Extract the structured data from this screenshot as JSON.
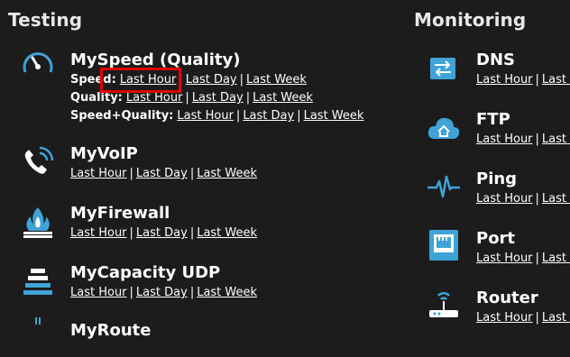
{
  "sections": {
    "testing": {
      "title": "Testing",
      "items": [
        {
          "title": "MySpeed (Quality)",
          "rows": [
            {
              "label": "Speed:",
              "links": [
                "Last Hour",
                "Last Day",
                "Last Week"
              ]
            },
            {
              "label": "Quality:",
              "links": [
                "Last Hour",
                "Last Day",
                "Last Week"
              ]
            },
            {
              "label": "Speed+Quality:",
              "links": [
                "Last Hour",
                "Last Day",
                "Last Week"
              ]
            }
          ]
        },
        {
          "title": "MyVoIP",
          "links": [
            "Last Hour",
            "Last Day",
            "Last Week"
          ]
        },
        {
          "title": "MyFirewall",
          "links": [
            "Last Hour",
            "Last Day",
            "Last Week"
          ]
        },
        {
          "title": "MyCapacity UDP",
          "links": [
            "Last Hour",
            "Last Day",
            "Last Week"
          ]
        },
        {
          "title": "MyRoute"
        }
      ]
    },
    "monitoring": {
      "title": "Monitoring",
      "items": [
        {
          "title": "DNS",
          "links": [
            "Last Hour",
            "Last Day"
          ]
        },
        {
          "title": "FTP",
          "links": [
            "Last Hour",
            "Last Day"
          ]
        },
        {
          "title": "Ping",
          "links": [
            "Last Hour",
            "Last Day"
          ]
        },
        {
          "title": "Port",
          "links": [
            "Last Hour",
            "Last Day"
          ]
        },
        {
          "title": "Router",
          "links": [
            "Last Hour",
            "Last Day"
          ]
        }
      ]
    }
  },
  "colors": {
    "background": "#1c1c1c",
    "icon_blue": "#3fa3d8",
    "highlight": "#e00000"
  },
  "icons": [
    "speedometer-icon",
    "phone-icon",
    "firewall-icon",
    "stack-icon",
    "route-icon",
    "dns-icon",
    "cloud-icon",
    "pulse-icon",
    "ethernet-port-icon",
    "router-icon"
  ]
}
